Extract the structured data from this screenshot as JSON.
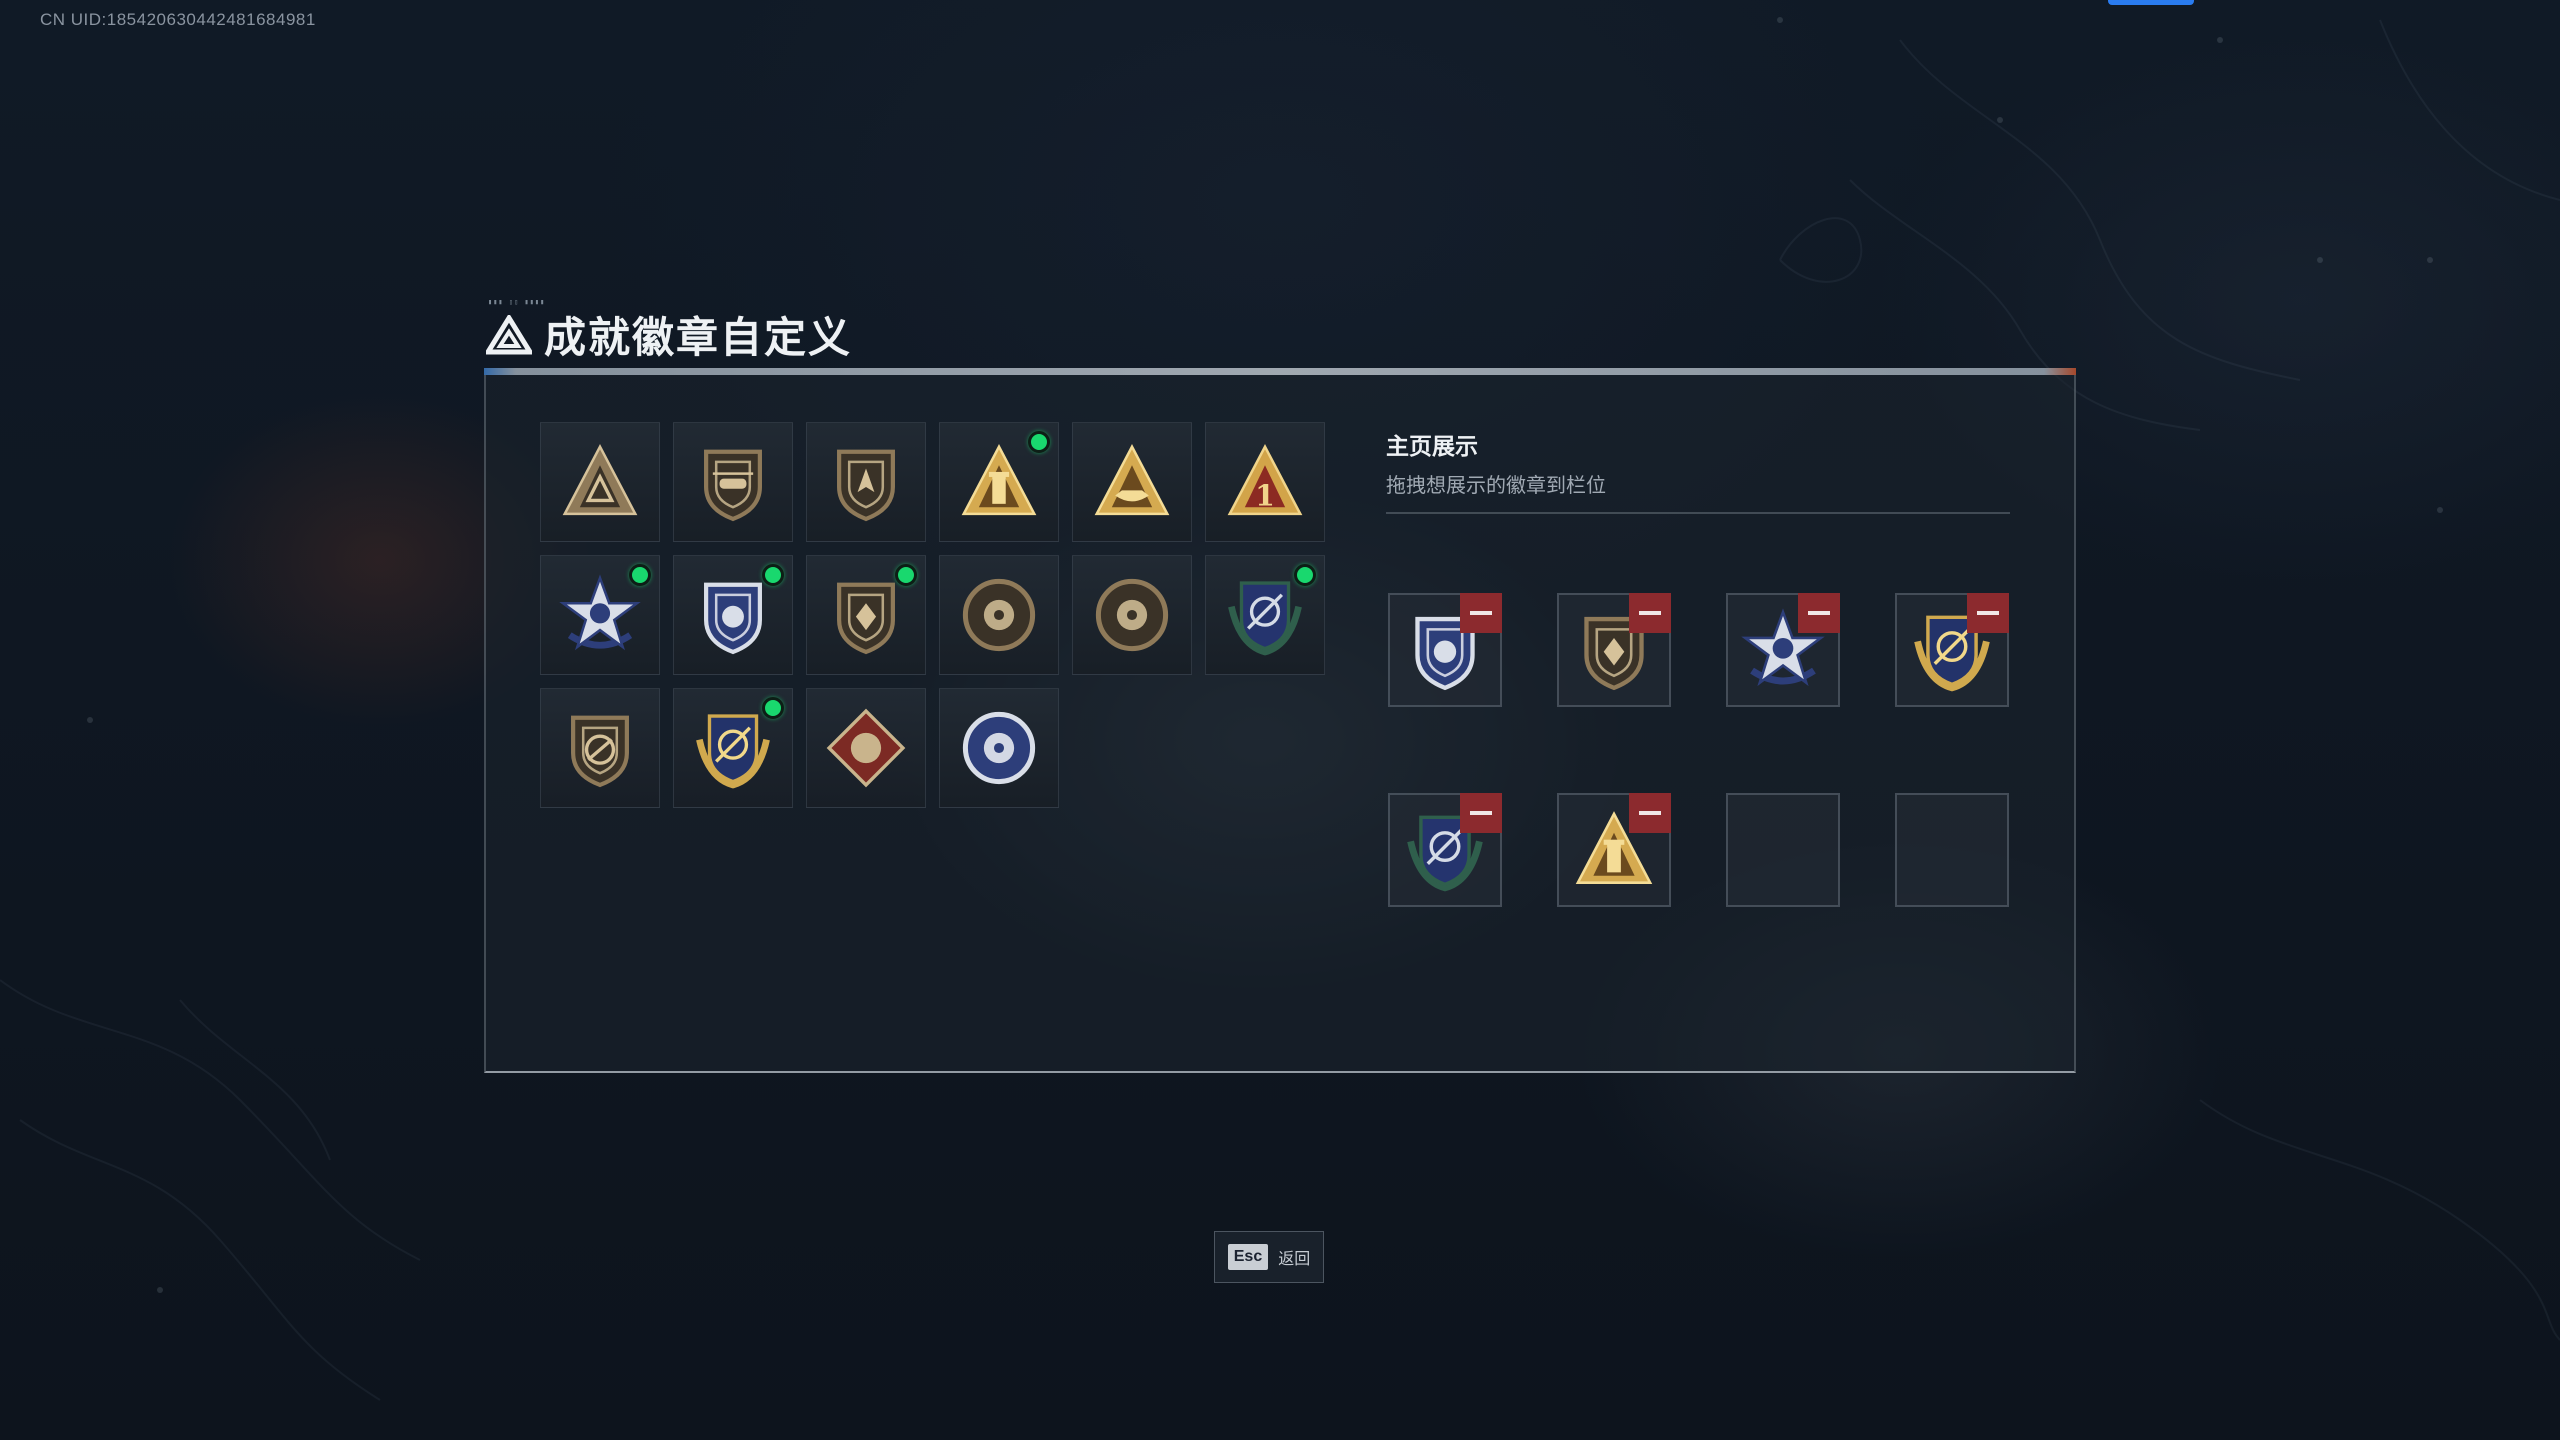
{
  "uid_text": "CN UID:1854206304424816849​81",
  "page": {
    "title": "成就徽章自定义"
  },
  "showcase": {
    "title": "主页展示",
    "subtitle": "拖拽想展示的徽章到栏位"
  },
  "back": {
    "key": "Esc",
    "label": "返回"
  },
  "colors": {
    "accent_blue": "#2a7cf0",
    "new_dot": "#19d86e",
    "remove": "#8c2a2e",
    "gold": "#c9a45a",
    "navy": "#2d3e7a",
    "bronze": "#8a7250"
  },
  "badges": [
    {
      "icon": "bronze-shield-triangle-badge-icon",
      "new": false
    },
    {
      "icon": "bronze-helicopter-shield-badge-icon",
      "new": false
    },
    {
      "icon": "bronze-arrowhead-shield-badge-icon",
      "new": false
    },
    {
      "icon": "gold-lighthouse-triangle-badge-icon",
      "new": true
    },
    {
      "icon": "gold-ship-triangle-badge-icon",
      "new": false
    },
    {
      "icon": "red-gold-number-one-triangle-badge-icon",
      "new": false
    },
    {
      "icon": "blue-star-eagle-badge-icon",
      "new": true
    },
    {
      "icon": "blue-police-shield-badge-icon",
      "new": true
    },
    {
      "icon": "bronze-diamond-shield-badge-icon",
      "new": true
    },
    {
      "icon": "bronze-skull-crosshair-badge-icon",
      "new": false
    },
    {
      "icon": "bronze-mask-crosshair-badge-icon",
      "new": false
    },
    {
      "icon": "green-navy-crosshair-laurel-badge-icon",
      "new": true
    },
    {
      "icon": "bronze-rifle-prohibition-badge-icon",
      "new": false
    },
    {
      "icon": "gold-navy-wings-crosshair-badge-icon",
      "new": true
    },
    {
      "icon": "red-diamond-beast-badge-icon",
      "new": false
    },
    {
      "icon": "blue-wolf-round-badge-icon",
      "new": false
    }
  ],
  "showcase_slots": [
    {
      "icon": "blue-police-shield-badge-icon",
      "removable": true
    },
    {
      "icon": "bronze-diamond-shield-badge-icon",
      "removable": true
    },
    {
      "icon": "blue-star-eagle-badge-icon",
      "removable": true
    },
    {
      "icon": "gold-navy-wings-crosshair-badge-icon",
      "removable": true
    },
    {
      "icon": "green-navy-crosshair-laurel-badge-icon",
      "removable": true
    },
    {
      "icon": "gold-lighthouse-triangle-badge-icon",
      "removable": true
    },
    {
      "icon": "",
      "removable": false
    },
    {
      "icon": "",
      "removable": false
    }
  ]
}
